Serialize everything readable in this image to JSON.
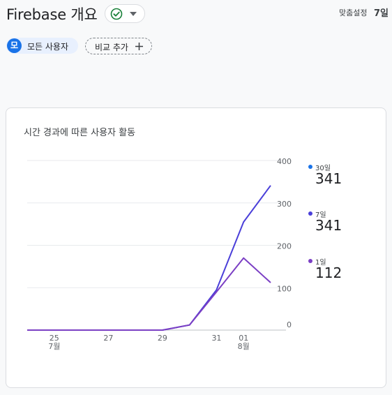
{
  "header": {
    "title": "Firebase 개요",
    "status_icon": "check-circle-icon",
    "status_color": "#188038",
    "date_label": "맞춤설정",
    "date_value": "7일"
  },
  "filters": {
    "all_users_badge": "모",
    "all_users_label": "모든 사용자",
    "compare_label": "비교 추가",
    "badge_color": "#1a73e8"
  },
  "card": {
    "title": "시간 경과에 따른 사용자 활동"
  },
  "legend": [
    {
      "name": "30일",
      "value": "341",
      "color": "#1a73e8"
    },
    {
      "name": "7일",
      "value": "341",
      "color": "#4a3fd9"
    },
    {
      "name": "1일",
      "value": "112",
      "color": "#7b3fc4"
    }
  ],
  "chart_data": {
    "type": "line",
    "x": [
      "07-24",
      "07-25",
      "07-26",
      "07-27",
      "07-28",
      "07-29",
      "07-30",
      "07-31",
      "08-01",
      "08-02"
    ],
    "x_tick_labels": [
      {
        "x": "07-25",
        "label": "25",
        "sublabel": "7월"
      },
      {
        "x": "07-27",
        "label": "27",
        "sublabel": ""
      },
      {
        "x": "07-29",
        "label": "29",
        "sublabel": ""
      },
      {
        "x": "07-31",
        "label": "31",
        "sublabel": ""
      },
      {
        "x": "08-01",
        "label": "01",
        "sublabel": "8월"
      }
    ],
    "y_ticks": [
      0,
      100,
      200,
      300,
      400
    ],
    "ylim": [
      0,
      400
    ],
    "grid": true,
    "y_axis_position": "right",
    "series": [
      {
        "name": "7일",
        "color": "#4a3fd9",
        "values": [
          0,
          0,
          0,
          0,
          0,
          0,
          12,
          95,
          255,
          341
        ]
      },
      {
        "name": "1일",
        "color": "#7b3fc4",
        "values": [
          0,
          0,
          0,
          0,
          0,
          0,
          12,
          90,
          170,
          112
        ]
      }
    ]
  }
}
